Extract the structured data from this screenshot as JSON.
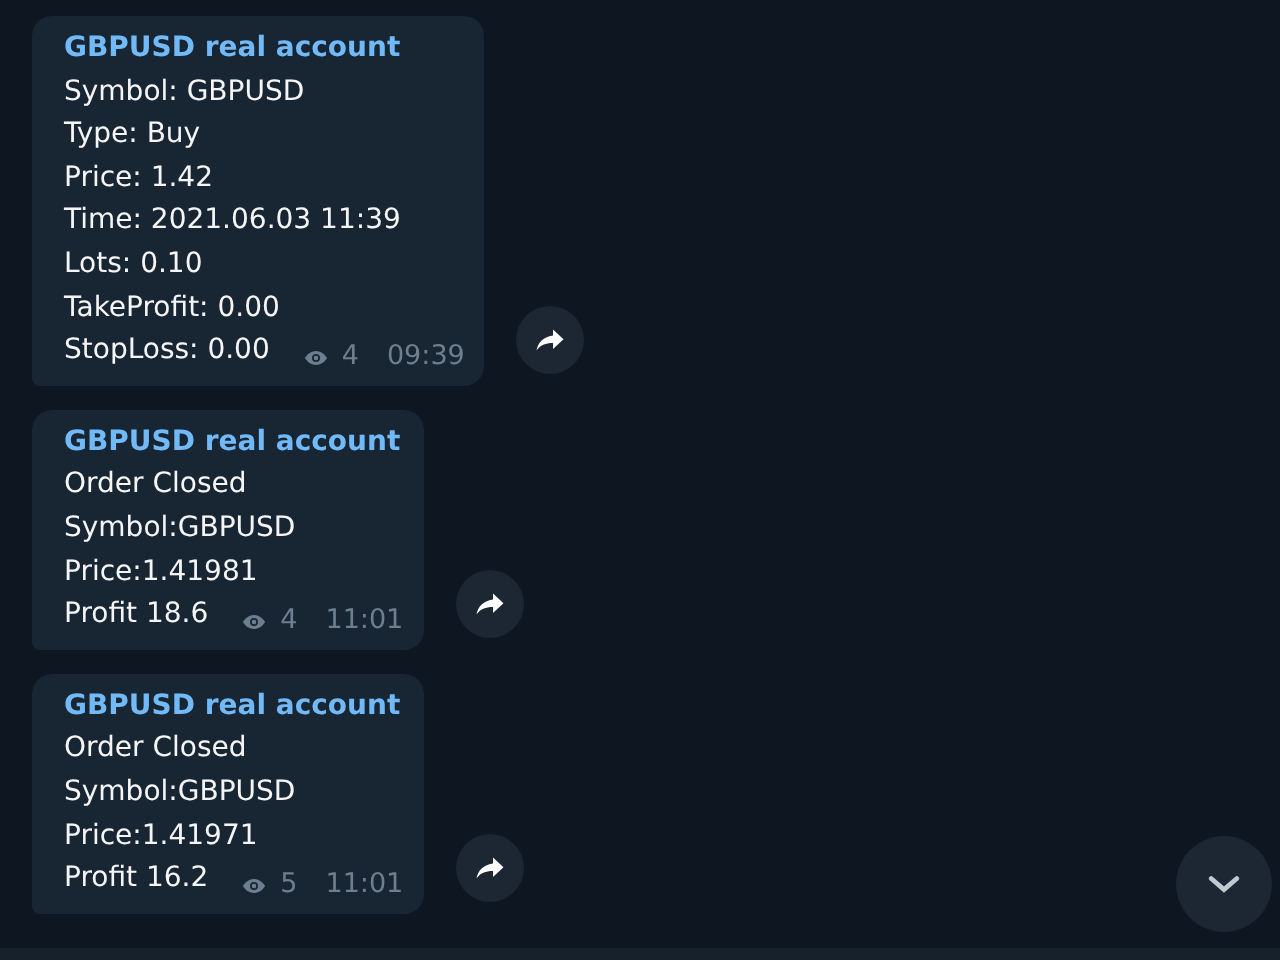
{
  "messages": [
    {
      "sender": "GBPUSD real account",
      "lines": [
        "Symbol: GBPUSD",
        "Type: Buy",
        "Price: 1.42",
        "Time: 2021.06.03 11:39",
        "Lots: 0.10",
        "TakeProfit: 0.00",
        "StopLoss: 0.00"
      ],
      "views": "4",
      "time": "09:39"
    },
    {
      "sender": "GBPUSD real account",
      "lines": [
        "Order Closed",
        "Symbol:GBPUSD",
        "Price:1.41981",
        "Profit 18.6"
      ],
      "views": "4",
      "time": "11:01"
    },
    {
      "sender": "GBPUSD real account",
      "lines": [
        "Order Closed",
        "Symbol:GBPUSD",
        "Price:1.41971",
        "Profit 16.2"
      ],
      "views": "5",
      "time": "11:01"
    }
  ]
}
